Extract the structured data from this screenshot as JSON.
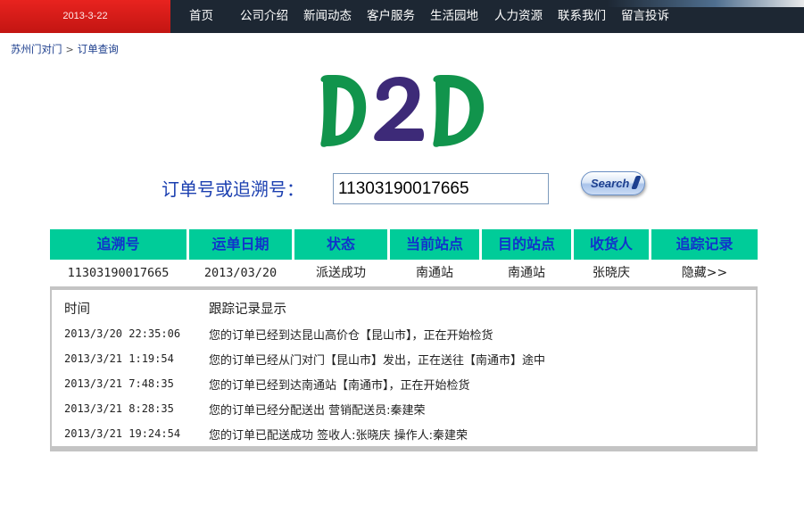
{
  "header": {
    "date": "2013-3-22",
    "nav": [
      "首页",
      "公司介绍",
      "新闻动态",
      "客户服务",
      "生活园地",
      "人力资源",
      "联系我们",
      "留言投诉"
    ]
  },
  "breadcrumb": {
    "items": [
      "苏州门对门",
      "订单查询"
    ],
    "separator": ">"
  },
  "logo": {
    "text": "D2D",
    "colors": {
      "d": "#11944c",
      "two": "#3d2a78"
    }
  },
  "search": {
    "label": "订单号或追溯号：",
    "value": "11303190017665",
    "button_label": "Search"
  },
  "result": {
    "columns": [
      "追溯号",
      "运单日期",
      "状态",
      "当前站点",
      "目的站点",
      "收货人",
      "追踪记录"
    ],
    "row": {
      "tracking_no": "11303190017665",
      "order_date": "2013/03/20",
      "status": "派送成功",
      "current_station": "南通站",
      "destination_station": "南通站",
      "receiver": "张晓庆",
      "toggle": "隐藏>>"
    }
  },
  "tracking": {
    "col_time": "时间",
    "col_record": "跟踪记录显示",
    "records": [
      {
        "time": "2013/3/20 22:35:06",
        "message": "您的订单已经到达昆山高价仓【昆山市】，正在开始检货"
      },
      {
        "time": "2013/3/21 1:19:54",
        "message": "您的订单已经从门对门【昆山市】发出，正在送往【南通市】途中"
      },
      {
        "time": "2013/3/21 7:48:35",
        "message": "您的订单已经到达南通站【南通市】，正在开始检货"
      },
      {
        "time": "2013/3/21 8:28:35",
        "message": "您的订单已经分配送出 营销配送员:秦建荣"
      },
      {
        "time": "2013/3/21 19:24:54",
        "message": "您的订单已配送成功 签收人:张晓庆 操作人:秦建荣"
      }
    ]
  },
  "colors": {
    "header_bg": "#1d2733",
    "date_bg": "#d81c18",
    "table_header_bg": "#00cc99",
    "table_header_text": "#1133cc",
    "label_blue": "#1b3fb0"
  },
  "icons": {
    "breadcrumb_separator": "chevron-right-icon"
  }
}
